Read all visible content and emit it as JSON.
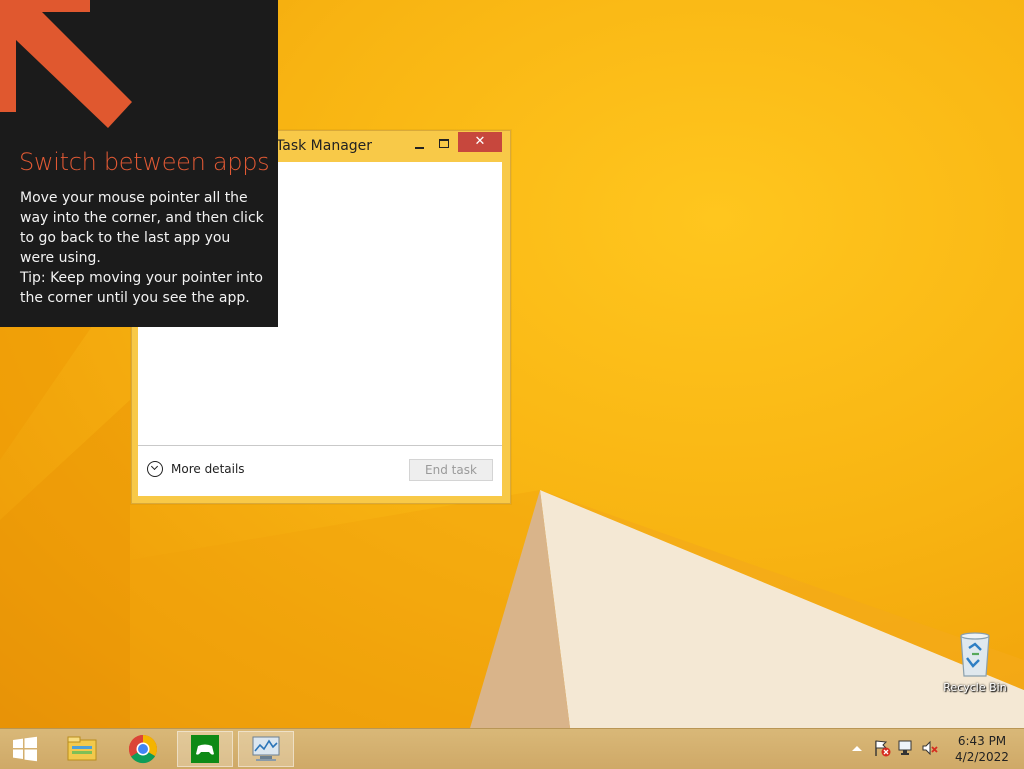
{
  "tip": {
    "title": "Switch between apps",
    "body_line1": "Move your mouse pointer all the way into the corner, and then click to go back to the last app you were using.",
    "body_line2": "Tip: Keep moving your pointer into the corner until you see the app."
  },
  "task_manager": {
    "title": "Task Manager",
    "close_glyph": "✕",
    "more_details": "More details",
    "end_task": "End task"
  },
  "desktop": {
    "recycle_bin_label": "Recycle Bin"
  },
  "taskbar": {
    "icons": [
      "start-icon",
      "file-explorer-icon",
      "chrome-icon",
      "xbox-games-icon",
      "task-manager-icon"
    ],
    "active": "task-manager-icon",
    "tray_icons": [
      "show-hidden-icons-icon",
      "action-center-flag-icon",
      "network-icon",
      "volume-muted-icon"
    ],
    "time": "6:43 PM",
    "date": "4/2/2022"
  },
  "colors": {
    "accent_tip_title": "#e15934",
    "wallpaper": "#f8b412",
    "close_button": "#c7473d"
  }
}
